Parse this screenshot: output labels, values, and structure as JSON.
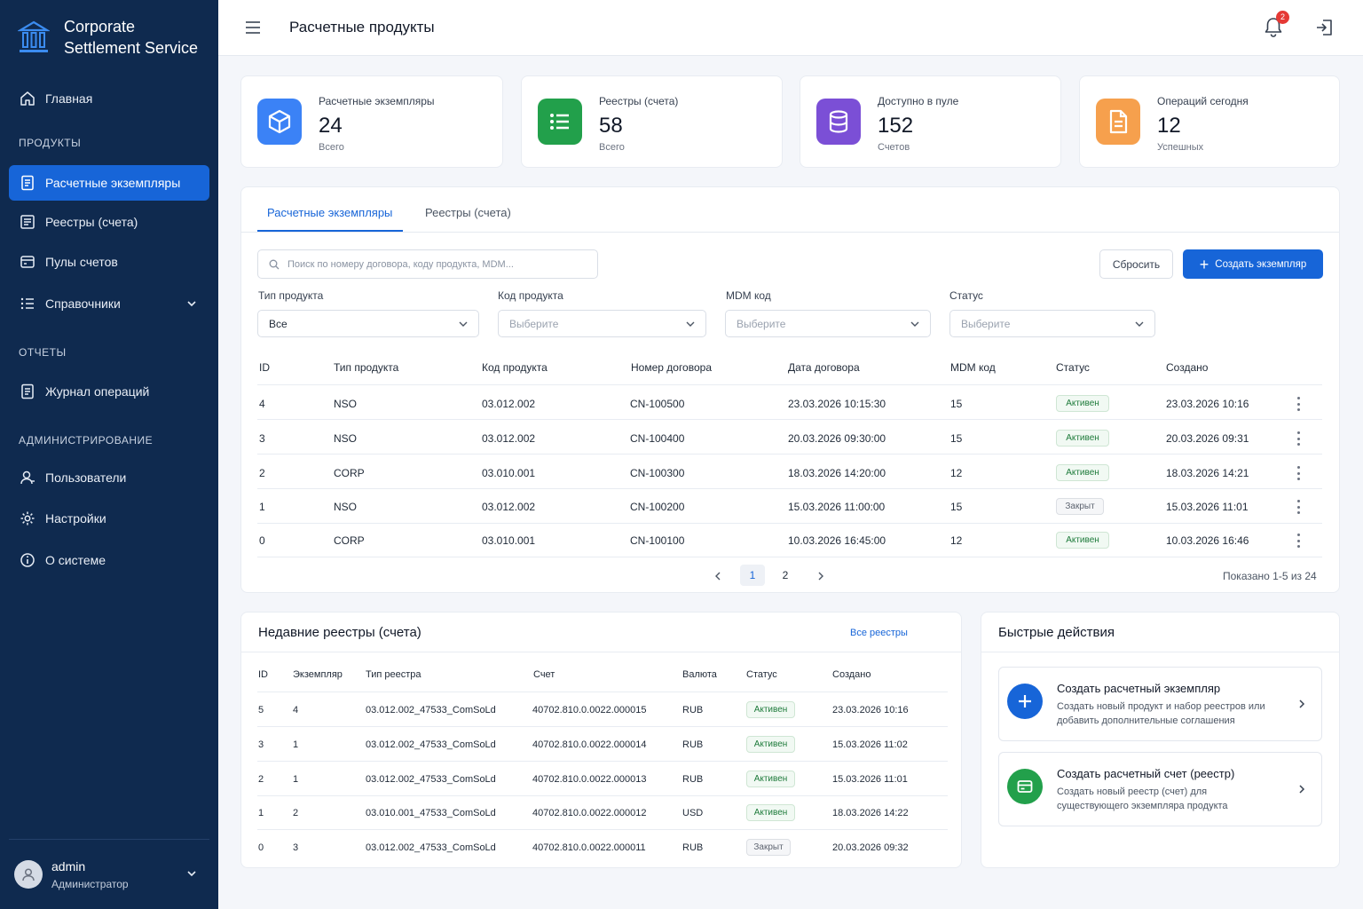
{
  "brand": {
    "line1": "Corporate",
    "line2": "Settlement Service"
  },
  "sidebar": {
    "home": "Главная",
    "section_products": "ПРОДУКТЫ",
    "items_products": [
      "Расчетные экземпляры",
      "Реестры (счета)",
      "Пулы счетов",
      "Справочники"
    ],
    "section_reports": "ОТЧЕТЫ",
    "journal": "Журнал операций",
    "section_admin": "АДМИНИСТРИРОВАНИЕ",
    "items_admin": [
      "Пользователи",
      "Настройки",
      "О системе"
    ],
    "user": {
      "name": "admin",
      "role": "Администратор"
    }
  },
  "header": {
    "title": "Расчетные продукты",
    "notifications": "2"
  },
  "stats": [
    {
      "label": "Расчетные экземпляры",
      "value": "24",
      "sub": "Всего",
      "color": "#3b82f6",
      "icon": "cube-icon"
    },
    {
      "label": "Реестры (счета)",
      "value": "58",
      "sub": "Всего",
      "color": "#22a04b",
      "icon": "list-icon"
    },
    {
      "label": "Доступно в пуле",
      "value": "152",
      "sub": "Счетов",
      "color": "#7b4fd6",
      "icon": "database-icon"
    },
    {
      "label": "Операций сегодня",
      "value": "12",
      "sub": "Успешных",
      "color": "#f6a04d",
      "icon": "document-icon"
    }
  ],
  "tabs": [
    "Расчетные экземпляры",
    "Реестры (счета)"
  ],
  "filters": {
    "search_placeholder": "Поиск по номеру договора, коду продукта, MDM...",
    "reset": "Сбросить",
    "create": "Создать экземпляр",
    "labels": [
      "Тип продукта",
      "Код продукта",
      "MDM код",
      "Статус"
    ],
    "values": [
      "Все",
      "Выберите",
      "Выберите",
      "Выберите"
    ]
  },
  "instances": {
    "headers": [
      "ID",
      "Тип продукта",
      "Код продукта",
      "Номер договора",
      "Дата договора",
      "MDM код",
      "Статус",
      "Создано"
    ],
    "rows": [
      [
        "4",
        "NSO",
        "03.012.002",
        "CN-100500",
        "23.03.2026 10:15:30",
        "15",
        "Активен",
        "23.03.2026 10:16"
      ],
      [
        "3",
        "NSO",
        "03.012.002",
        "CN-100400",
        "20.03.2026 09:30:00",
        "15",
        "Активен",
        "20.03.2026 09:31"
      ],
      [
        "2",
        "CORP",
        "03.010.001",
        "CN-100300",
        "18.03.2026 14:20:00",
        "12",
        "Активен",
        "18.03.2026 14:21"
      ],
      [
        "1",
        "NSO",
        "03.012.002",
        "CN-100200",
        "15.03.2026 11:00:00",
        "15",
        "Закрыт",
        "15.03.2026 11:01"
      ],
      [
        "0",
        "CORP",
        "03.010.001",
        "CN-100100",
        "10.03.2026 16:45:00",
        "12",
        "Активен",
        "10.03.2026 16:46"
      ]
    ],
    "pages": [
      "1",
      "2"
    ],
    "shown": "Показано 1-5 из 24"
  },
  "recent": {
    "title": "Недавние реестры (счета)",
    "link": "Все реестры",
    "headers": [
      "ID",
      "Экземпляр",
      "Тип реестра",
      "Счет",
      "Валюта",
      "Статус",
      "Создано"
    ],
    "rows": [
      [
        "5",
        "4",
        "03.012.002_47533_ComSoLd",
        "40702.810.0.0022.000015",
        "RUB",
        "Активен",
        "23.03.2026 10:16"
      ],
      [
        "3",
        "1",
        "03.012.002_47533_ComSoLd",
        "40702.810.0.0022.000014",
        "RUB",
        "Активен",
        "15.03.2026 11:02"
      ],
      [
        "2",
        "1",
        "03.012.002_47533_ComSoLd",
        "40702.810.0.0022.000013",
        "RUB",
        "Активен",
        "15.03.2026 11:01"
      ],
      [
        "1",
        "2",
        "03.010.001_47533_ComSoLd",
        "40702.810.0.0022.000012",
        "USD",
        "Активен",
        "18.03.2026 14:22"
      ],
      [
        "0",
        "3",
        "03.012.002_47533_ComSoLd",
        "40702.810.0.0022.000011",
        "RUB",
        "Закрыт",
        "20.03.2026 09:32"
      ]
    ]
  },
  "quick": {
    "title": "Быстрые действия",
    "actions": [
      {
        "title": "Создать расчетный экземпляр",
        "desc": "Создать новый продукт и набор реестров или добавить дополнительные соглашения",
        "color": "#1765d8"
      },
      {
        "title": "Создать расчетный счет (реестр)",
        "desc": "Создать новый реестр (счет) для существующего экземпляра продукта",
        "color": "#22a04b"
      }
    ]
  }
}
